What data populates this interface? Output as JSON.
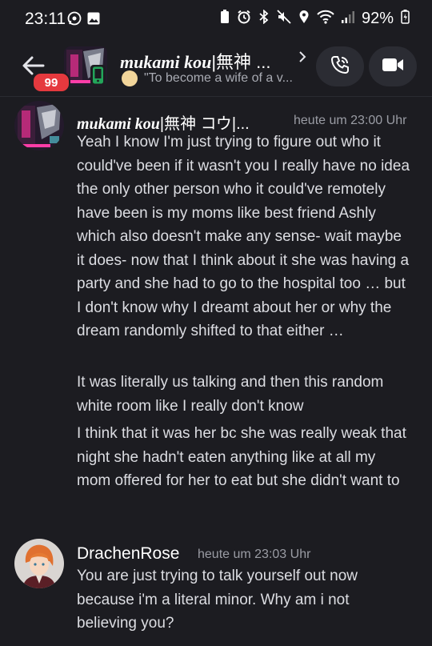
{
  "status_bar": {
    "time": "23:11",
    "battery": "92%"
  },
  "header": {
    "name_script": "mukami kou",
    "name_rest": "|無神 ...",
    "status": "\"To become a wife of a v...",
    "unread_badge": "99"
  },
  "messages": [
    {
      "author_script": "mukami kou",
      "author_rest": "|無神 コウ|...",
      "timestamp": "heute um 23:00 Uhr",
      "paragraphs": [
        "Yeah I know I'm just trying to figure out who it could've been if it wasn't you I really have no idea the only other person who it could've remotely have been is my moms like best friend Ashly which also doesn't make any sense- wait maybe it does- now that I think about it she was having a party and she had to go to the hospital too … but I don't know why I dreamt about her or why the dream randomly shifted to that either …",
        "It was literally us talking and then this random white room like I really don't know",
        "I think that it was her bc she was really weak that night she hadn't eaten anything like at all my mom offered for her to eat but she didn't want to"
      ]
    },
    {
      "author": "DrachenRose",
      "timestamp": "heute um 23:03 Uhr",
      "paragraphs": [
        "You are just trying to talk yourself out now because i'm a literal minor. Why am i not believing you?"
      ]
    }
  ]
}
